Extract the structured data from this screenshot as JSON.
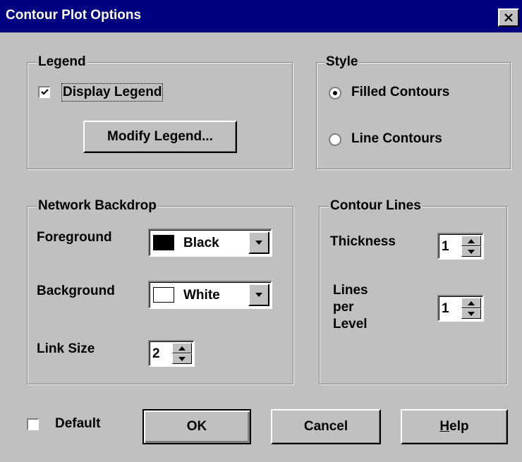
{
  "window": {
    "title": "Contour Plot Options"
  },
  "legend_group": {
    "label": "Legend",
    "display_legend": {
      "label": "Display Legend",
      "checked": true
    },
    "modify_button": "Modify Legend..."
  },
  "style_group": {
    "label": "Style",
    "options": [
      {
        "label": "Filled Contours",
        "selected": true
      },
      {
        "label": "Line Contours",
        "selected": false
      }
    ]
  },
  "backdrop_group": {
    "label": "Network Backdrop",
    "foreground": {
      "label": "Foreground",
      "value": "Black",
      "color": "#000000"
    },
    "background": {
      "label": "Background",
      "value": "White",
      "color": "#ffffff"
    },
    "link_size": {
      "label": "Link Size",
      "value": "2"
    }
  },
  "contour_lines_group": {
    "label": "Contour Lines",
    "thickness": {
      "label": "Thickness",
      "value": "1"
    },
    "lines_per_level": {
      "label_line1": "Lines",
      "label_line2": "per",
      "label_line3": "Level",
      "value": "1"
    }
  },
  "footer": {
    "default_checkbox": {
      "label": "Default",
      "checked": false
    },
    "ok_button": "OK",
    "cancel_button": "Cancel",
    "help_button_mnemonic": "H",
    "help_button_rest": "elp"
  }
}
